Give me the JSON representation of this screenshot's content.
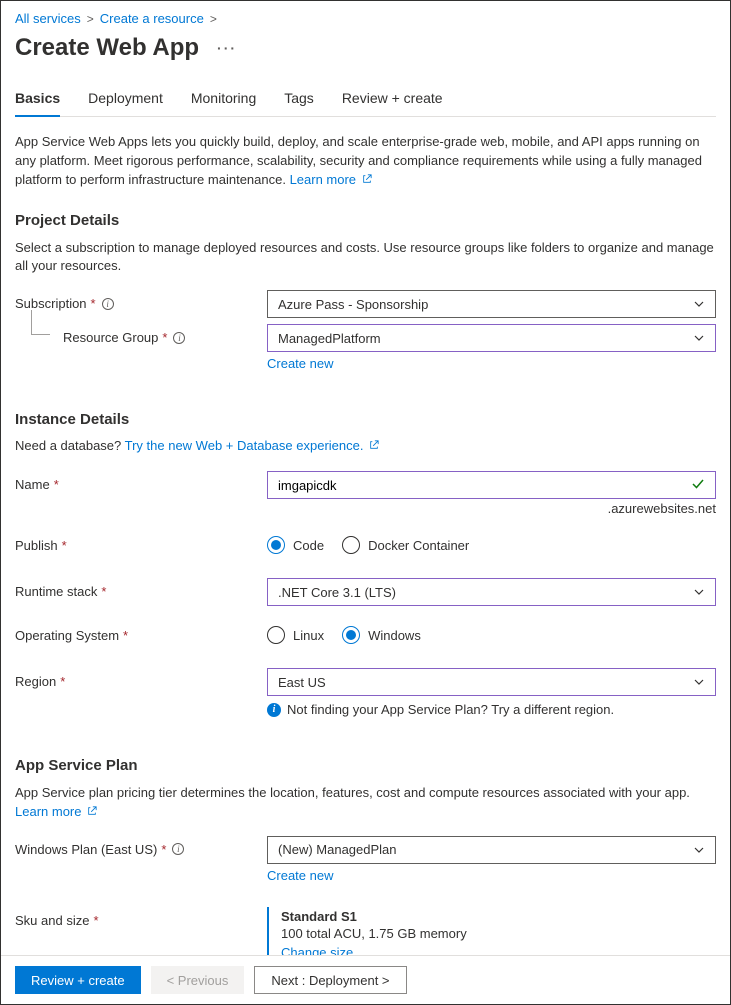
{
  "breadcrumb": {
    "level1": "All services",
    "level2": "Create a resource"
  },
  "title": "Create Web App",
  "tabs": {
    "basics": "Basics",
    "deployment": "Deployment",
    "monitoring": "Monitoring",
    "tags": "Tags",
    "review": "Review + create"
  },
  "intro": {
    "text": "App Service Web Apps lets you quickly build, deploy, and scale enterprise-grade web, mobile, and API apps running on any platform. Meet rigorous performance, scalability, security and compliance requirements while using a fully managed platform to perform infrastructure maintenance.  ",
    "learn_more": "Learn more"
  },
  "project_details": {
    "heading": "Project Details",
    "desc": "Select a subscription to manage deployed resources and costs. Use resource groups like folders to organize and manage all your resources.",
    "subscription_label": "Subscription",
    "subscription_value": "Azure Pass - Sponsorship",
    "resource_group_label": "Resource Group",
    "resource_group_value": "ManagedPlatform",
    "create_new": "Create new"
  },
  "instance_details": {
    "heading": "Instance Details",
    "need_db_prefix": "Need a database? ",
    "need_db_link": "Try the new Web + Database experience.",
    "name_label": "Name",
    "name_value": "imgapicdk",
    "name_suffix": ".azurewebsites.net",
    "publish_label": "Publish",
    "publish_options": {
      "code": "Code",
      "docker": "Docker Container"
    },
    "runtime_label": "Runtime stack",
    "runtime_value": ".NET Core 3.1 (LTS)",
    "os_label": "Operating System",
    "os_options": {
      "linux": "Linux",
      "windows": "Windows"
    },
    "region_label": "Region",
    "region_value": "East US",
    "region_hint": "Not finding your App Service Plan? Try a different region."
  },
  "app_service_plan": {
    "heading": "App Service Plan",
    "desc_prefix": "App Service plan pricing tier determines the location, features, cost and compute resources associated with your app. ",
    "learn_more": "Learn more",
    "plan_label": "Windows Plan (East US)",
    "plan_value": "(New) ManagedPlan",
    "create_new": "Create new",
    "sku_label": "Sku and size",
    "sku_title": "Standard S1",
    "sku_sub": "100 total ACU, 1.75 GB memory",
    "change_size": "Change size"
  },
  "footer": {
    "review": "Review + create",
    "previous": "< Previous",
    "next": "Next : Deployment >"
  }
}
